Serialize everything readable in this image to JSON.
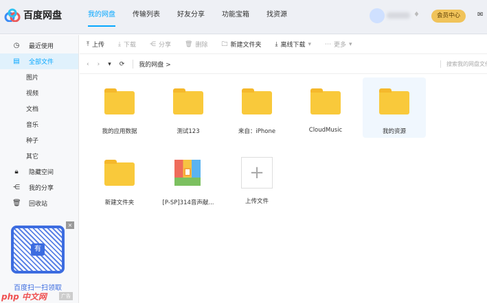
{
  "header": {
    "logo": "百度网盘",
    "nav": [
      "我的网盘",
      "传输列表",
      "好友分享",
      "功能宝箱",
      "找资源"
    ],
    "vip": "会员中心"
  },
  "sidebar": [
    {
      "label": "最近使用",
      "icon": "clock-icon"
    },
    {
      "label": "全部文件",
      "icon": "file-icon"
    },
    {
      "label": "图片"
    },
    {
      "label": "视频"
    },
    {
      "label": "文档"
    },
    {
      "label": "音乐"
    },
    {
      "label": "种子"
    },
    {
      "label": "其它"
    },
    {
      "label": "隐藏空间",
      "icon": "lock-icon"
    },
    {
      "label": "我的分享",
      "icon": "share-icon"
    },
    {
      "label": "回收站",
      "icon": "trash-icon"
    }
  ],
  "ad": {
    "text": "百度扫一扫领取",
    "tag": "广告",
    "close": "×",
    "code": "有"
  },
  "toolbar": {
    "upload": "上传",
    "download": "下载",
    "share": "分享",
    "delete": "删除",
    "new_folder": "新建文件夹",
    "offline": "离线下载",
    "more": "更多"
  },
  "breadcrumb": {
    "path": "我的网盘",
    "sep": ">",
    "search_placeholder": "搜索我的网盘文件"
  },
  "files": [
    "我的应用数据",
    "测试123",
    "来自：iPhone",
    "CloudMusic",
    "我的资源",
    "新建文件夹",
    "[P-SP]314音声献...",
    "上传文件"
  ]
}
